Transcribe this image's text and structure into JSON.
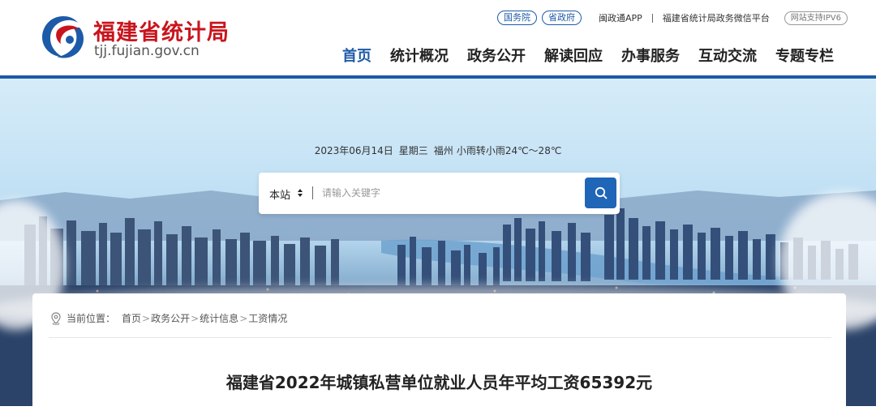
{
  "header": {
    "site_name": "福建省统计局",
    "domain": "tjj.fujian.gov.cn",
    "top_links": {
      "pill1": "国务院",
      "pill2": "省政府",
      "app": "闽政通APP",
      "wechat": "福建省统计局政务微信平台",
      "ipv6": "网站支持IPV6"
    },
    "nav": [
      "首页",
      "统计概况",
      "政务公开",
      "解读回应",
      "办事服务",
      "互动交流",
      "专题专栏"
    ],
    "accent_color": "#1d5aa8",
    "brand_color": "#c8151d"
  },
  "banner": {
    "date": "2023年06月14日",
    "weekday": "星期三",
    "city": "福州",
    "weather": "小雨转小雨24℃～28℃",
    "search": {
      "scope": "本站",
      "placeholder": "请输入关键字"
    }
  },
  "content": {
    "breadcrumb_label": "当前位置：",
    "breadcrumb": [
      "首页",
      "政务公开",
      "统计信息",
      "工资情况"
    ],
    "breadcrumb_sep": ">",
    "title": "福建省2022年城镇私营单位就业人员年平均工资65392元"
  }
}
